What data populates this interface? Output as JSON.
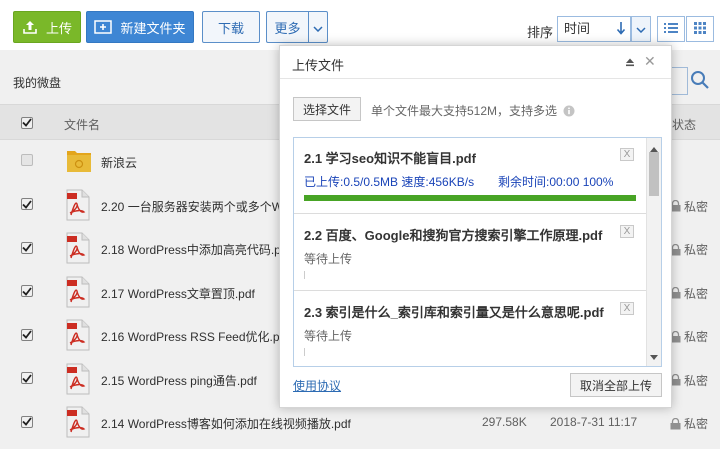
{
  "toolbar": {
    "upload_label": "上传",
    "new_folder_label": "新建文件夹",
    "download_label": "下载",
    "more_label": "更多",
    "sort_label": "排序",
    "sort_value": "时间"
  },
  "breadcrumb": {
    "current": "我的微盘"
  },
  "table": {
    "header_name": "文件名",
    "header_status": "状态",
    "rows": [
      {
        "name": "新浪云",
        "type": "folder",
        "checked": false,
        "size": "",
        "date": "",
        "privacy": ""
      },
      {
        "name": "2.20 一台服务器安装两个或多个W",
        "type": "pdf",
        "checked": true,
        "size": "",
        "date": "",
        "privacy": "私密"
      },
      {
        "name": "2.18 WordPress中添加高亮代码.p",
        "type": "pdf",
        "checked": true,
        "size": "",
        "date": "",
        "privacy": "私密"
      },
      {
        "name": "2.17 WordPress文章置顶.pdf",
        "type": "pdf",
        "checked": true,
        "size": "",
        "date": "",
        "privacy": "私密"
      },
      {
        "name": "2.16 WordPress RSS Feed优化.p",
        "type": "pdf",
        "checked": true,
        "size": "",
        "date": "",
        "privacy": "私密"
      },
      {
        "name": "2.15 WordPress ping通告.pdf",
        "type": "pdf",
        "checked": true,
        "size": "",
        "date": "",
        "privacy": "私密"
      },
      {
        "name": "2.14 WordPress博客如何添加在线视频播放.pdf",
        "type": "pdf",
        "checked": true,
        "size": "297.58K",
        "date": "2018-7-31 11:17",
        "privacy": "私密"
      }
    ]
  },
  "dialog": {
    "title": "上传文件",
    "choose_label": "选择文件",
    "tip": "单个文件最大支持512M，支持多选",
    "terms_label": "使用协议",
    "cancel_all_label": "取消全部上传",
    "close_glyph": "✕",
    "queue": [
      {
        "name": "2.1 学习seo知识不能盲目.pdf",
        "progress_text": "已上传:0.5/0.5MB 速度:456KB/s",
        "remaining_text": "剩余时间:00:00 100%",
        "progress": 1.0,
        "status": ""
      },
      {
        "name": "2.2 百度、Google和搜狗官方搜索引擎工作原理.pdf",
        "progress_text": "",
        "remaining_text": "",
        "progress": 0,
        "status": "等待上传"
      },
      {
        "name": "2.3 索引是什么_索引库和索引量又是什么意思呢.pdf",
        "progress_text": "",
        "remaining_text": "",
        "progress": 0,
        "status": "等待上传"
      }
    ],
    "remove_glyph": "X"
  },
  "colors": {
    "upload_green": "#7ab829",
    "primary_blue": "#3e86d4",
    "progress_green": "#48a425",
    "link_blue": "#2d6bb3"
  }
}
